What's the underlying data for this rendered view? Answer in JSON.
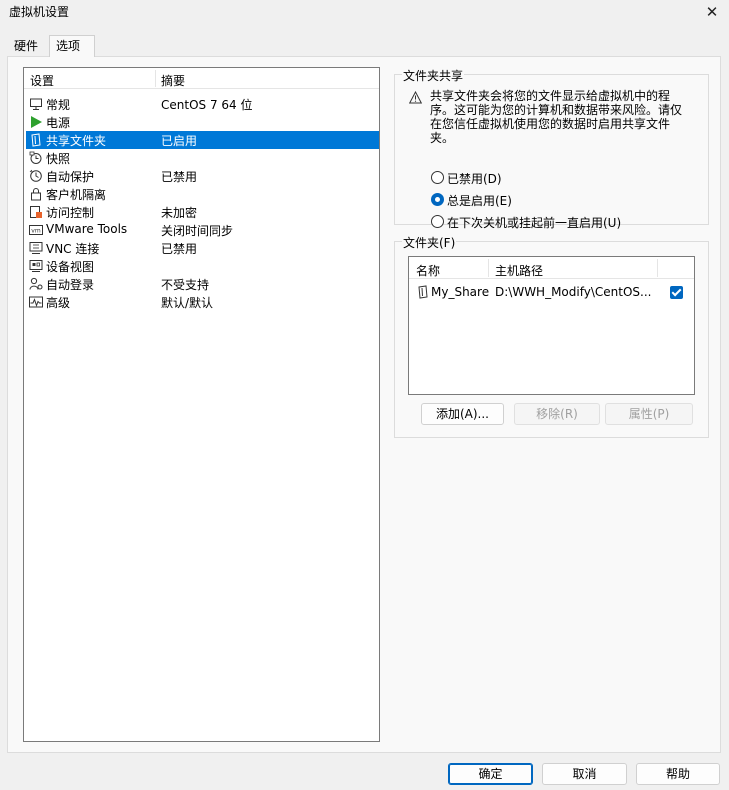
{
  "window": {
    "title": "虚拟机设置"
  },
  "tabs": [
    {
      "label": "硬件"
    },
    {
      "label": "选项"
    }
  ],
  "settings": {
    "headers": {
      "setting": "设置",
      "summary": "摘要"
    },
    "items": [
      {
        "name": "常规",
        "summary": "CentOS 7 64 位",
        "icon": "general-icon"
      },
      {
        "name": "电源",
        "summary": "",
        "icon": "power-icon"
      },
      {
        "name": "共享文件夹",
        "summary": "已启用",
        "icon": "shared-folder-icon"
      },
      {
        "name": "快照",
        "summary": "",
        "icon": "snapshot-icon"
      },
      {
        "name": "自动保护",
        "summary": "已禁用",
        "icon": "autoprotect-icon"
      },
      {
        "name": "客户机隔离",
        "summary": "",
        "icon": "lock-icon"
      },
      {
        "name": "访问控制",
        "summary": "未加密",
        "icon": "access-control-icon"
      },
      {
        "name": "VMware Tools",
        "summary": "关闭时间同步",
        "icon": "vmware-tools-icon"
      },
      {
        "name": "VNC 连接",
        "summary": "已禁用",
        "icon": "vnc-icon"
      },
      {
        "name": "设备视图",
        "summary": "",
        "icon": "device-view-icon"
      },
      {
        "name": "自动登录",
        "summary": "不受支持",
        "icon": "autologin-icon"
      },
      {
        "name": "高级",
        "summary": "默认/默认",
        "icon": "advanced-icon"
      }
    ],
    "selected_index": 2
  },
  "sharing": {
    "legend": "文件夹共享",
    "warning": "共享文件夹会将您的文件显示给虚拟机中的程序。这可能为您的计算机和数据带来风险。请仅在您信任虚拟机使用您的数据时启用共享文件夹。",
    "options": [
      {
        "label": "已禁用(D)",
        "checked": false
      },
      {
        "label": "总是启用(E)",
        "checked": true
      },
      {
        "label": "在下次关机或挂起前一直启用(U)",
        "checked": false
      }
    ]
  },
  "folders": {
    "legend": "文件夹(F)",
    "headers": {
      "name": "名称",
      "path": "主机路径"
    },
    "rows": [
      {
        "name": "My_Share",
        "path": "D:\\WWH_Modify\\CentOS...",
        "enabled": true
      }
    ],
    "buttons": {
      "add": "添加(A)...",
      "remove": "移除(R)",
      "properties": "属性(P)"
    }
  },
  "footer": {
    "ok": "确定",
    "cancel": "取消",
    "help": "帮助"
  },
  "colors": {
    "selection": "#0078d7",
    "accent": "#0067c0",
    "power_icon": "#2ea12e"
  }
}
